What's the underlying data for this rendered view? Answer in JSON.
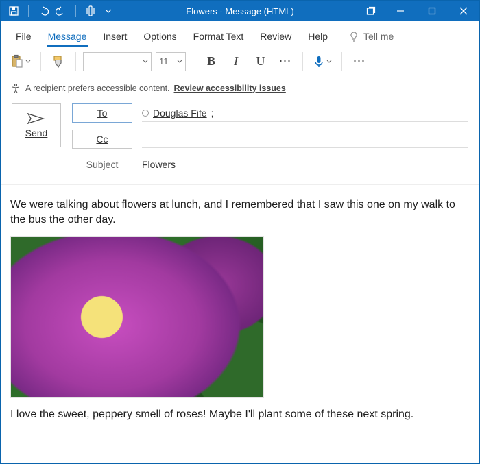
{
  "title": "Flowers  -  Message (HTML)",
  "ribbon": {
    "tabs": [
      "File",
      "Message",
      "Insert",
      "Options",
      "Format Text",
      "Review",
      "Help"
    ],
    "active_index": 1,
    "tell_me": "Tell me",
    "font_name": "",
    "font_size": "11",
    "buttons": {
      "bold": "B",
      "italic": "I",
      "underline": "U"
    }
  },
  "a11y": {
    "text": "A recipient prefers accessible content.",
    "link": "Review accessibility issues"
  },
  "compose": {
    "send": "Send",
    "to_label": "To",
    "cc_label": "Cc",
    "subject_label": "Subject",
    "recipient": "Douglas Fife",
    "recipient_suffix": ";",
    "cc_value": "",
    "subject_value": "Flowers"
  },
  "body": {
    "p1": "We were talking about flowers at lunch, and I remembered that I saw this one on my walk to the bus the other day.",
    "p2": "I love the sweet, peppery smell of roses! Maybe I'll plant some of these next spring."
  }
}
